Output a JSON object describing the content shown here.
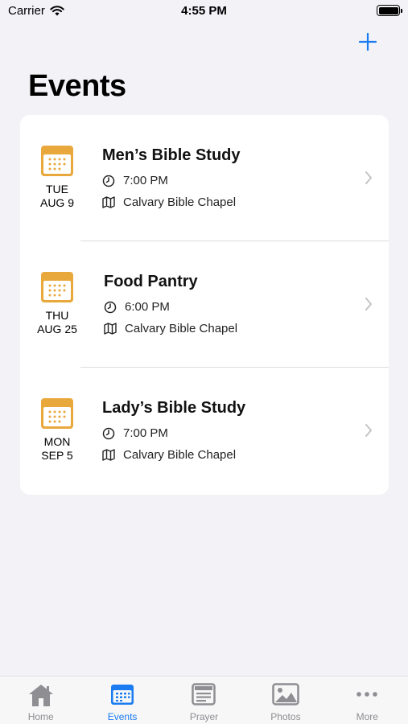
{
  "status_bar": {
    "carrier": "Carrier",
    "time": "4:55 PM"
  },
  "header": {
    "title": "Events",
    "add_icon": "plus-icon"
  },
  "colors": {
    "accent": "#1a7cf0",
    "calendar": "#e9a83c",
    "background": "#f2f2f7"
  },
  "events": [
    {
      "day": "TUE",
      "date": "AUG 9",
      "title": "Men’s Bible Study",
      "time": "7:00 PM",
      "location": "Calvary Bible Chapel"
    },
    {
      "day": "THU",
      "date": "AUG 25",
      "title": "Food Pantry",
      "time": "6:00 PM",
      "location": "Calvary Bible Chapel"
    },
    {
      "day": "MON",
      "date": "SEP 5",
      "title": "Lady’s Bible Study",
      "time": "7:00 PM",
      "location": "Calvary Bible Chapel"
    }
  ],
  "tabs": [
    {
      "label": "Home",
      "icon": "home-icon"
    },
    {
      "label": "Events",
      "icon": "calendar-icon",
      "active": true
    },
    {
      "label": "Prayer",
      "icon": "prayer-icon"
    },
    {
      "label": "Photos",
      "icon": "photo-icon"
    },
    {
      "label": "More",
      "icon": "more-icon"
    }
  ]
}
